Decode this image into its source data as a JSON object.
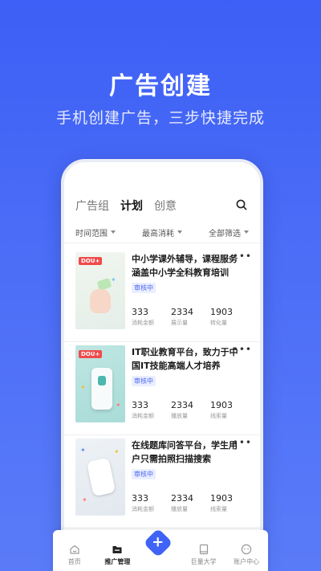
{
  "hero": {
    "title": "广告创建",
    "subtitle": "手机创建广告，三步快捷完成"
  },
  "tabs": [
    {
      "label": "广告组"
    },
    {
      "label": "计划"
    },
    {
      "label": "创意"
    }
  ],
  "filters": [
    {
      "label": "时间范围"
    },
    {
      "label": "最高消耗"
    },
    {
      "label": "全部筛选"
    }
  ],
  "cards": [
    {
      "title": "中小学课外辅导，课程服务涵盖中小学全科教育培训",
      "badge": "审核中",
      "thumb_tag": "DOU+",
      "more": "•••",
      "stats": [
        {
          "value": "333",
          "label": "消耗金额"
        },
        {
          "value": "2334",
          "label": "展示量"
        },
        {
          "value": "1903",
          "label": "转化量"
        }
      ]
    },
    {
      "title": "IT职业教育平台，致力于中国IT技能高端人才培养",
      "badge": "审核中",
      "thumb_tag": "DOU+",
      "more": "•••",
      "stats": [
        {
          "value": "333",
          "label": "消耗金额"
        },
        {
          "value": "2334",
          "label": "播放量"
        },
        {
          "value": "1903",
          "label": "线索量"
        }
      ]
    },
    {
      "title": "在线题库问答平台，学生用户只需拍照扫描搜索",
      "badge": "审核中",
      "thumb_tag": "",
      "more": "•••",
      "stats": [
        {
          "value": "333",
          "label": "消耗金额"
        },
        {
          "value": "2334",
          "label": "播放量"
        },
        {
          "value": "1903",
          "label": "线索量"
        }
      ]
    }
  ],
  "nav": [
    {
      "label": "首页",
      "icon": "home-icon"
    },
    {
      "label": "推广管理",
      "icon": "folder-icon"
    },
    {
      "label": "",
      "icon": "plus-icon"
    },
    {
      "label": "巨量大学",
      "icon": "book-icon"
    },
    {
      "label": "账户中心",
      "icon": "account-icon"
    }
  ],
  "colors": {
    "primary": "#3f63f6",
    "badge_text": "#4a66f5",
    "dou_tag": "#f04a4a"
  }
}
